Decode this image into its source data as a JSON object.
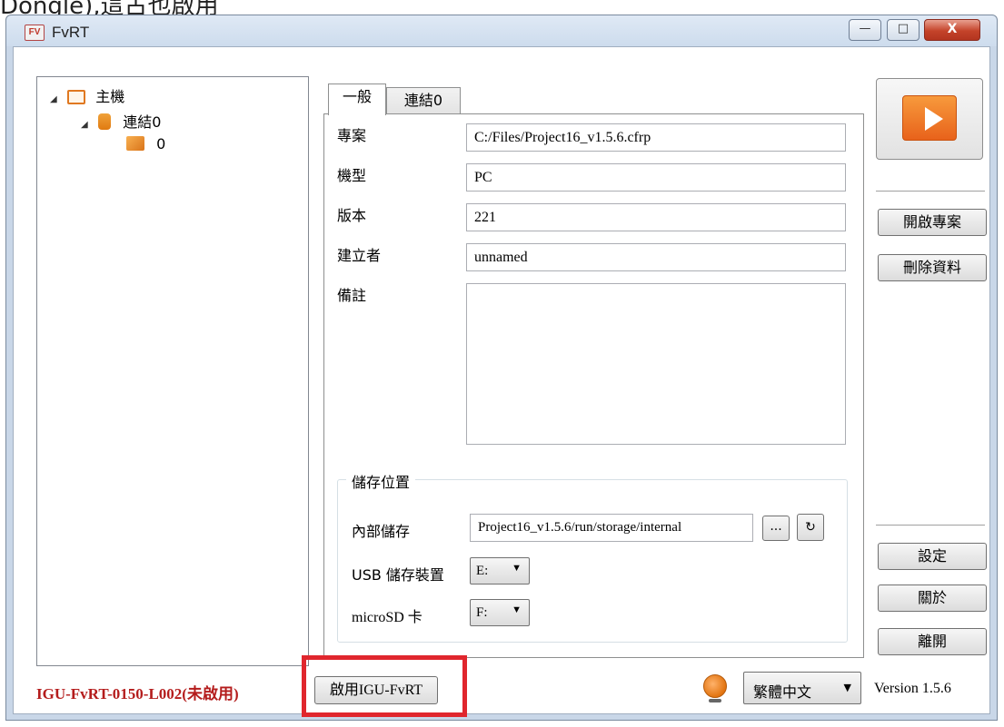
{
  "top_caption": "Dongle),這古也啟用",
  "window": {
    "title": "FvRT",
    "app_icon_text": "FV",
    "controls": {
      "minimize": "—",
      "maximize": "□",
      "close": "X"
    }
  },
  "tree": {
    "items": [
      {
        "label": "主機",
        "icon": "monitor-icon",
        "level": 0
      },
      {
        "label": "連結0",
        "icon": "database-icon",
        "level": 1
      },
      {
        "label": "0",
        "icon": "box-icon",
        "level": 2
      }
    ]
  },
  "tabs": [
    {
      "label": "一般",
      "active": true
    },
    {
      "label": "連結0",
      "active": false
    }
  ],
  "general": {
    "project_label": "專案",
    "project_value": "C:/Files/Project16_v1.5.6.cfrp",
    "model_label": "機型",
    "model_value": "PC",
    "version_label": "版本",
    "version_value": "221",
    "creator_label": "建立者",
    "creator_value": "unnamed",
    "notes_label": "備註",
    "notes_value": ""
  },
  "storage": {
    "group_title": "儲存位置",
    "internal_label": "內部儲存",
    "internal_value": "Project16_v1.5.6/run/storage/internal",
    "browse_label": "...",
    "refresh_icon": "refresh-icon",
    "usb_label": "USB 儲存裝置",
    "usb_value": "E:",
    "sd_label": "microSD 卡",
    "sd_value": "F:"
  },
  "side_buttons": {
    "run_icon": "play-icon",
    "open_project": "開啟專案",
    "delete_data": "刪除資料",
    "settings": "設定",
    "about": "關於",
    "exit": "離開"
  },
  "footer": {
    "license_status": "IGU-FvRT-0150-L002(未啟用)",
    "enable_button": "啟用IGU-FvRT",
    "language": "繁體中文",
    "version": "Version 1.5.6"
  },
  "colors": {
    "license_status": "#b41c1c",
    "highlight_box": "#e0262d",
    "play_button": "#e8621b"
  }
}
